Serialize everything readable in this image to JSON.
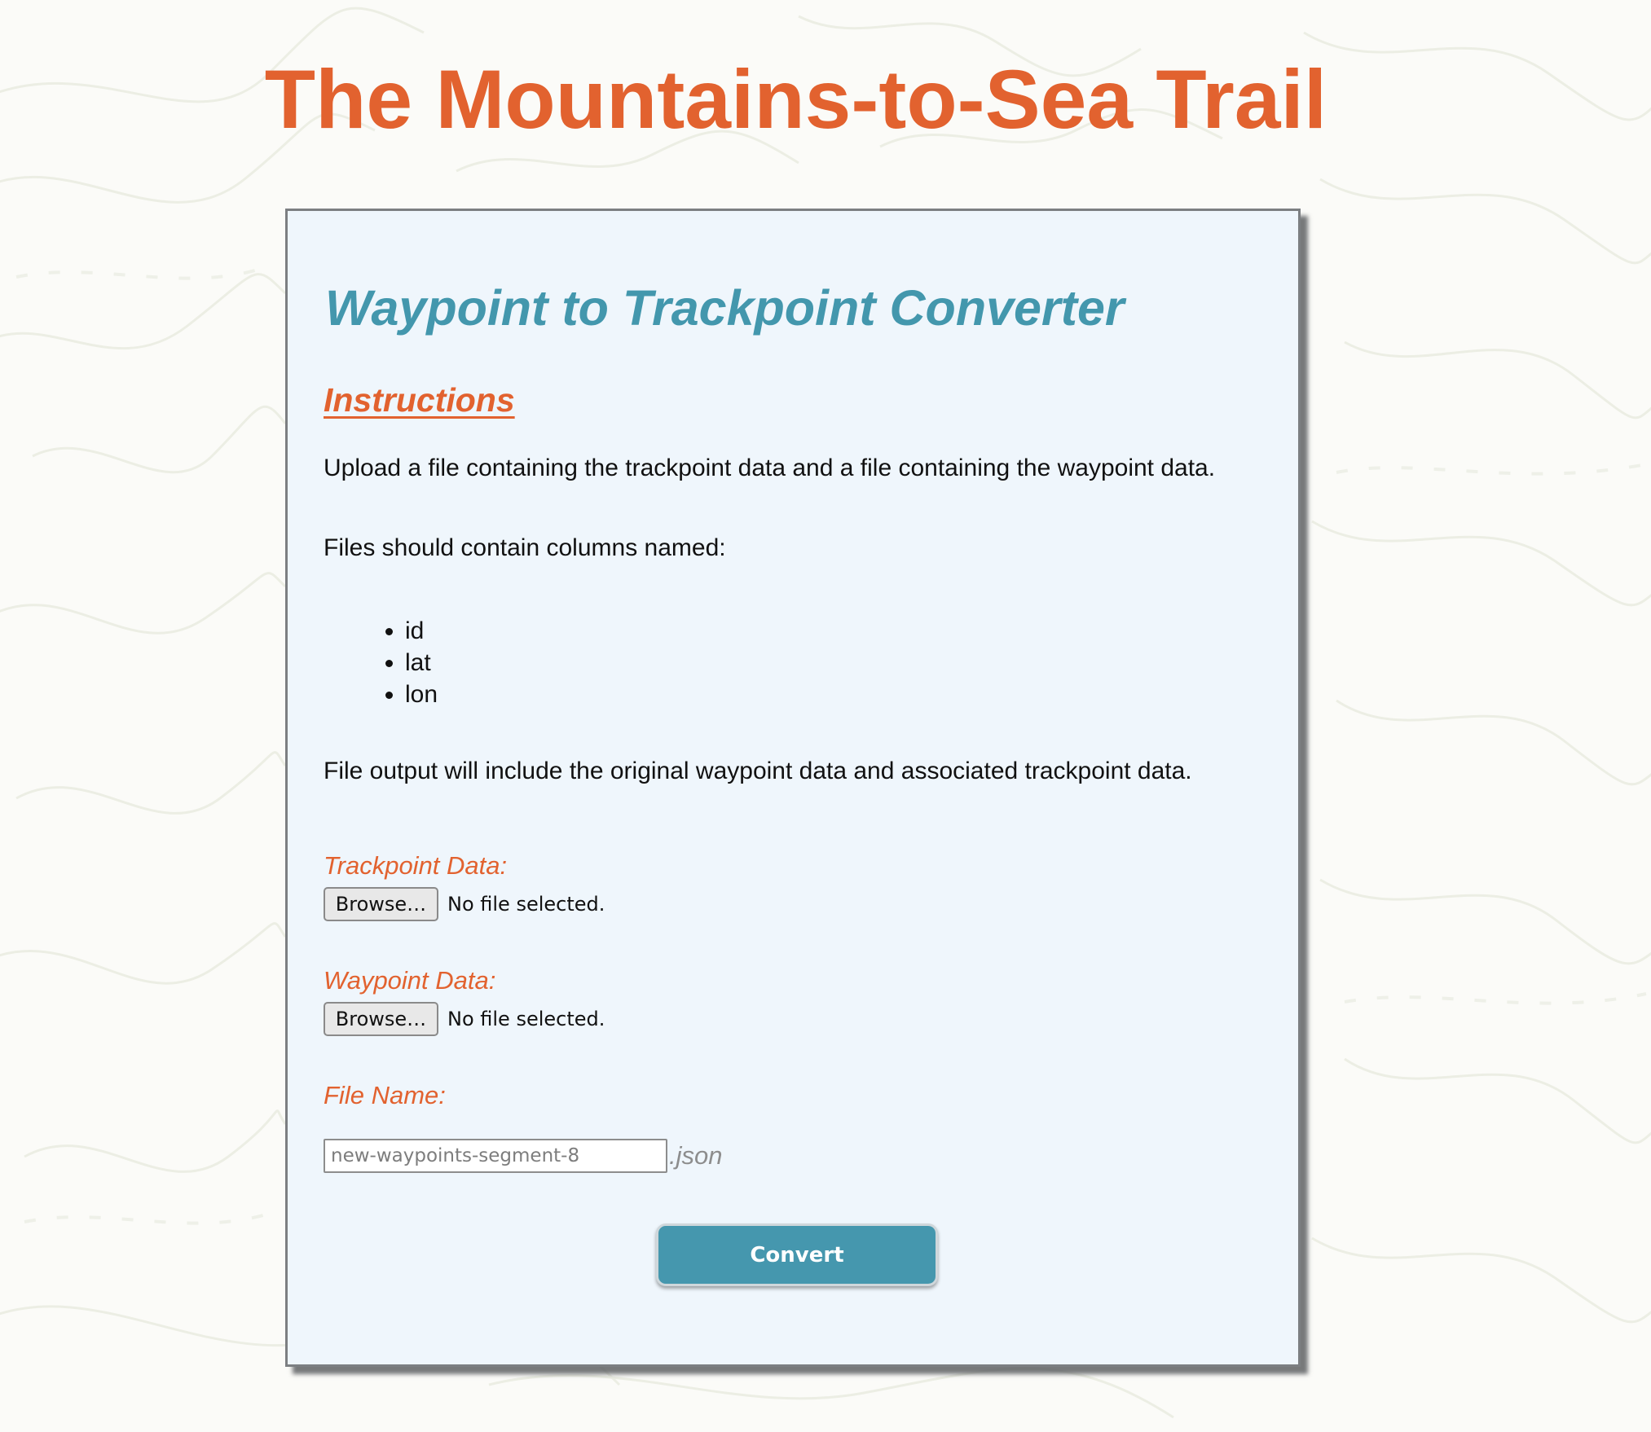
{
  "site": {
    "title": "The Mountains-to-Sea Trail"
  },
  "converter": {
    "title": "Waypoint to Trackpoint Converter",
    "instructions_heading": "Instructions",
    "paragraph_upload": "Upload a file containing the trackpoint data and a file containing the waypoint data.",
    "paragraph_columns": "Files should contain columns named:",
    "columns": [
      "id",
      "lat",
      "lon"
    ],
    "paragraph_output": "File output will include the original waypoint data and associated trackpoint data."
  },
  "form": {
    "trackpoint_label": "Trackpoint Data:",
    "trackpoint_browse": "Browse…",
    "trackpoint_status": "No file selected.",
    "waypoint_label": "Waypoint Data:",
    "waypoint_browse": "Browse…",
    "waypoint_status": "No file selected.",
    "filename_label": "File Name:",
    "filename_placeholder": "new-waypoints-segment-8",
    "filename_extension": ".json",
    "convert_label": "Convert"
  },
  "colors": {
    "brand_orange": "#e2622f",
    "accent_teal": "#4597ae",
    "panel_background": "#eff6fc"
  }
}
